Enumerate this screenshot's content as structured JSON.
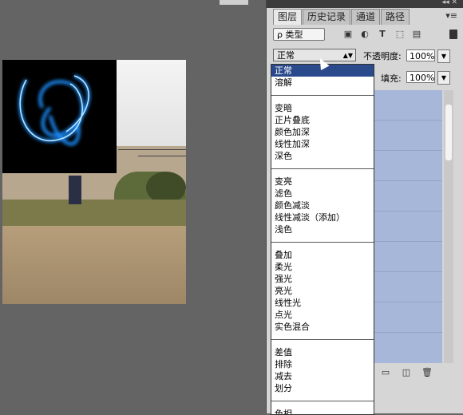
{
  "panel": {
    "tabs": [
      "图层",
      "历史记录",
      "通道",
      "路径"
    ],
    "filter_kind": "ρ 类型",
    "blend_mode": "正常",
    "opacity_label": "不透明度:",
    "opacity_value": "100%",
    "fill_label": "填充:",
    "fill_value": "100%"
  },
  "blend_menu": {
    "groups": [
      [
        "正常",
        "溶解"
      ],
      [
        "变暗",
        "正片叠底",
        "颜色加深",
        "线性加深",
        "深色"
      ],
      [
        "变亮",
        "滤色",
        "颜色减淡",
        "线性减淡（添加）",
        "浅色"
      ],
      [
        "叠加",
        "柔光",
        "强光",
        "亮光",
        "线性光",
        "点光",
        "实色混合"
      ],
      [
        "差值",
        "排除",
        "减去",
        "划分"
      ],
      [
        "色相"
      ]
    ],
    "selected": "正常"
  },
  "colors": {
    "selection": "#2b4a8c",
    "layers_bg": "#a7b7da",
    "workspace": "#646464"
  },
  "icons": {
    "filter_icons": [
      "image-filter-icon",
      "adjust-filter-icon",
      "type-filter-icon",
      "shape-filter-icon",
      "smart-filter-icon"
    ],
    "footer_icons": [
      "folder-icon",
      "new-layer-icon",
      "trash-icon"
    ]
  }
}
